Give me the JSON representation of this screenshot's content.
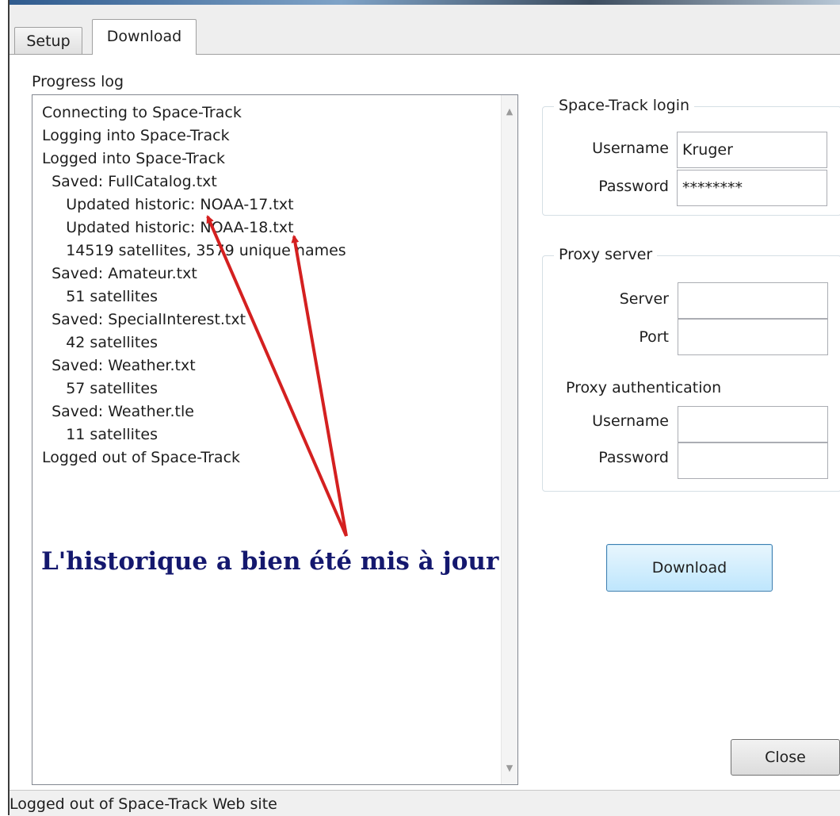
{
  "tabs": [
    {
      "label": "Setup"
    },
    {
      "label": "Download",
      "active": true
    }
  ],
  "progress_log": {
    "label": "Progress log",
    "lines": [
      "Connecting to Space-Track",
      "Logging into Space-Track",
      "Logged into Space-Track",
      "  Saved: FullCatalog.txt",
      "     Updated historic: NOAA-17.txt",
      "     Updated historic: NOAA-18.txt",
      "     14519 satellites, 3579 unique names",
      "  Saved: Amateur.txt",
      "     51 satellites",
      "  Saved: SpecialInterest.txt",
      "     42 satellites",
      "  Saved: Weather.txt",
      "     57 satellites",
      "  Saved: Weather.tle",
      "     11 satellites",
      "Logged out of Space-Track"
    ]
  },
  "annotation": {
    "text": "L'historique a bien été  mis à jour",
    "color": "#14186e",
    "arrow_color": "#d42020"
  },
  "login": {
    "legend": "Space-Track login",
    "username_label": "Username",
    "username_value": "Kruger",
    "password_label": "Password",
    "password_value": "********"
  },
  "proxy": {
    "legend": "Proxy server",
    "server_label": "Server",
    "server_value": "",
    "port_label": "Port",
    "port_value": "",
    "auth_label": "Proxy authentication",
    "username_label": "Username",
    "username_value": "",
    "password_label": "Password",
    "password_value": ""
  },
  "buttons": {
    "download": "Download",
    "close": "Close"
  },
  "status": {
    "text": "Logged out of Space-Track Web site"
  }
}
